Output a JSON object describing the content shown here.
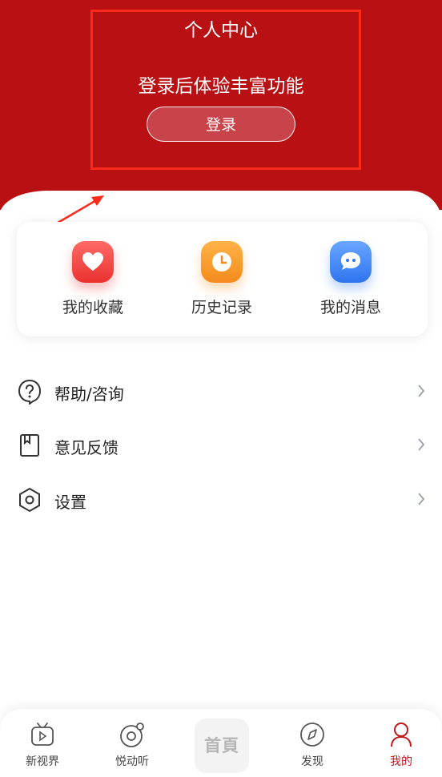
{
  "header": {
    "title": "个人中心",
    "login_tip": "登录后体验丰富功能",
    "login_button": "登录"
  },
  "quick_actions": [
    {
      "label": "我的收藏",
      "icon": "heart-icon",
      "color": "#f2403e"
    },
    {
      "label": "历史记录",
      "icon": "clock-icon",
      "color": "#f79a2a"
    },
    {
      "label": "我的消息",
      "icon": "chat-bubble-icon",
      "color": "#3f86f5"
    }
  ],
  "menu": [
    {
      "label": "帮助/咨询",
      "icon": "help-question-icon"
    },
    {
      "label": "意见反馈",
      "icon": "feedback-bookmark-icon"
    },
    {
      "label": "设置",
      "icon": "settings-hexagon-icon"
    }
  ],
  "tabbar": {
    "items": [
      {
        "label": "新视界",
        "icon": "tv-play-icon"
      },
      {
        "label": "悦动听",
        "icon": "music-disc-icon"
      },
      {
        "label": "首頁",
        "icon": "home-logo"
      },
      {
        "label": "发现",
        "icon": "compass-icon"
      },
      {
        "label": "我的",
        "icon": "person-icon",
        "active": true
      }
    ],
    "active_color": "#c2161b"
  },
  "colors": {
    "header_bg": "#b91113",
    "annotation": "#ff2a1a"
  }
}
